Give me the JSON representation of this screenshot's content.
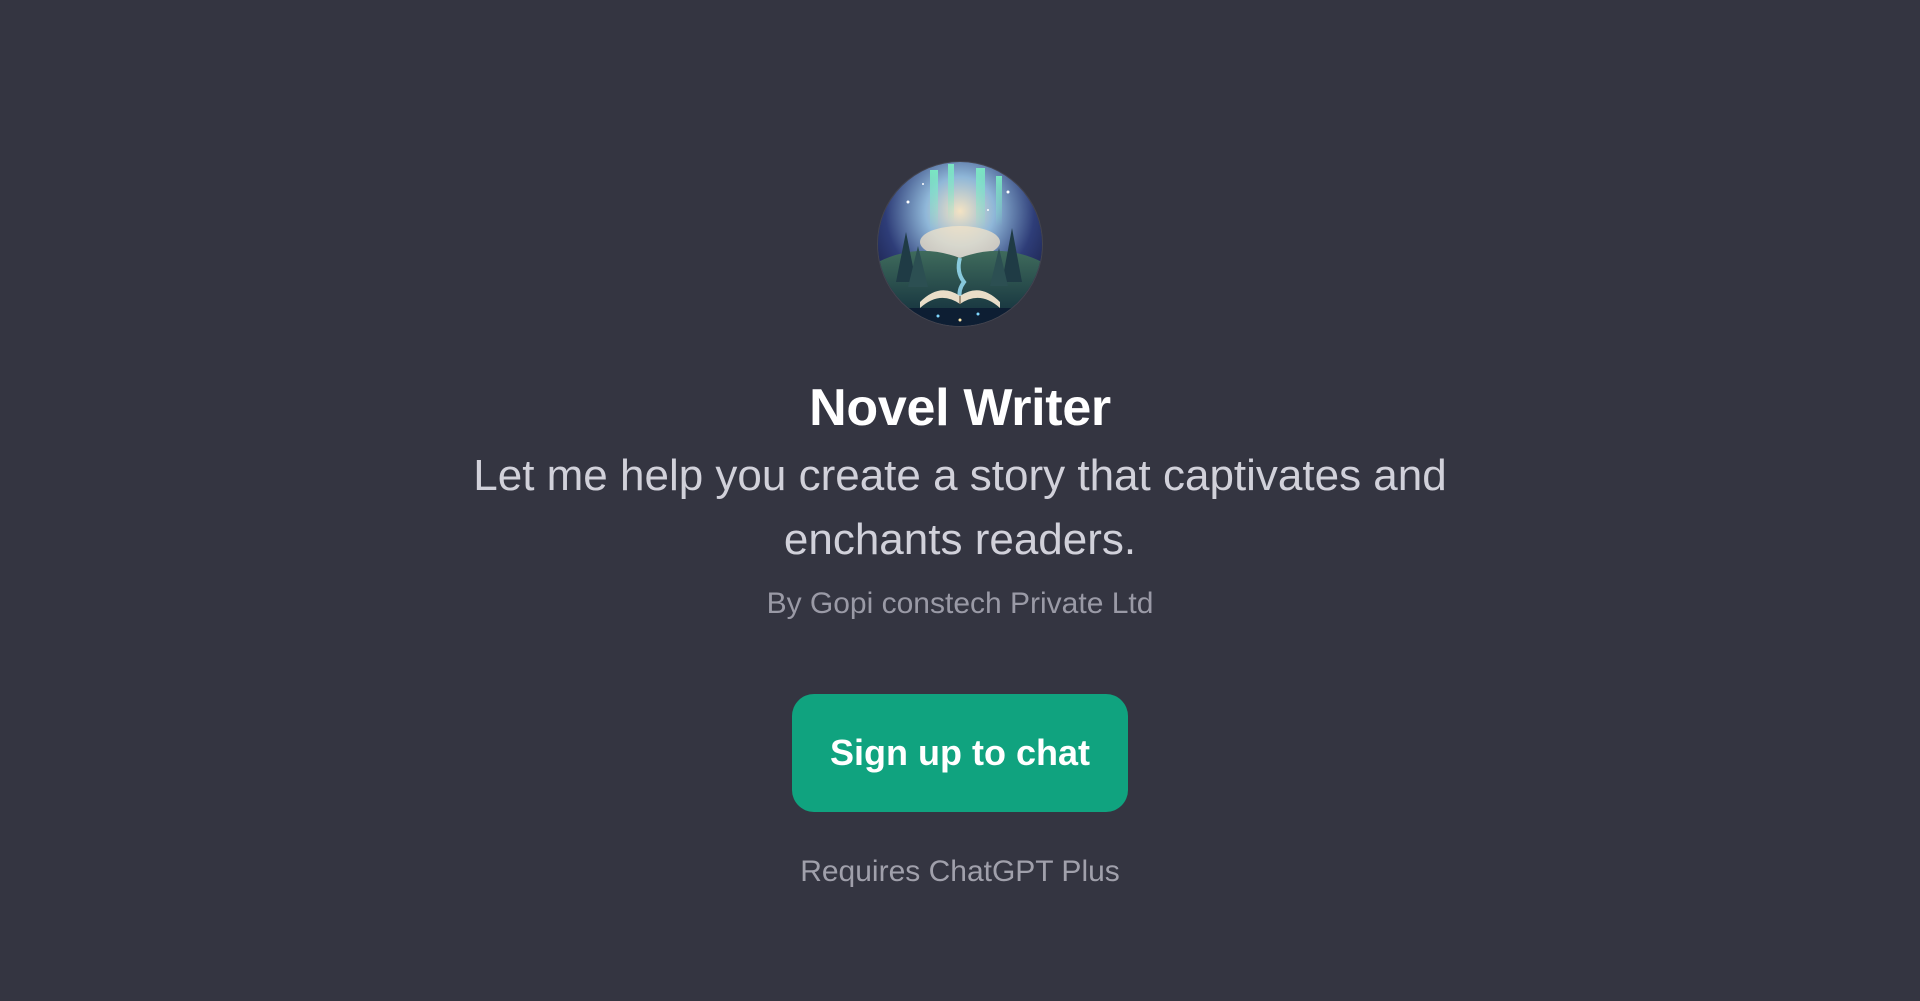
{
  "gpt": {
    "title": "Novel Writer",
    "description": "Let me help you create a story that captivates and enchants readers.",
    "author": "By Gopi constech Private Ltd",
    "avatar_icon": "enchanted-book-landscape-image"
  },
  "actions": {
    "signup_label": "Sign up to chat",
    "requirement_note": "Requires ChatGPT Plus"
  },
  "colors": {
    "background": "#343541",
    "accent": "#10a37f",
    "title": "#ffffff",
    "description": "#d1d1da",
    "muted": "#9a9aa6"
  }
}
